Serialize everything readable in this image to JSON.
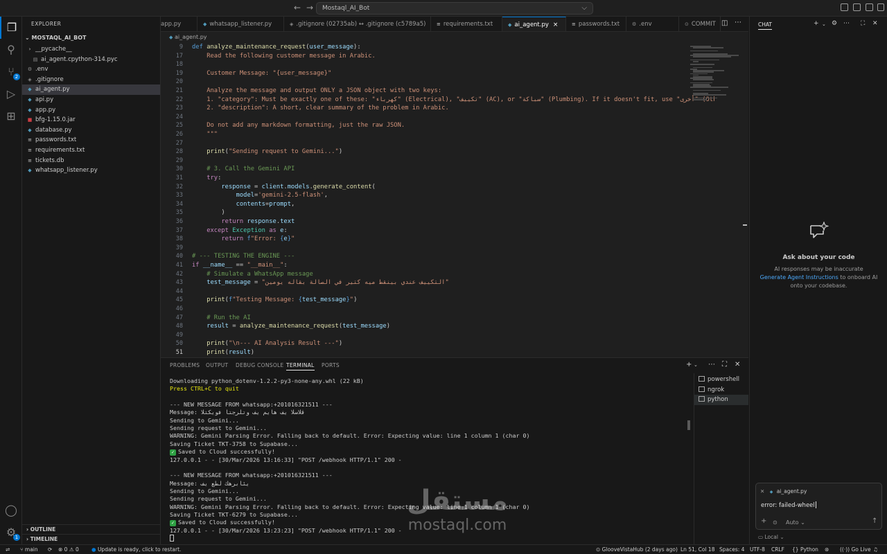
{
  "title": {
    "search": "Mostaql_AI_Bot"
  },
  "explorer": {
    "header": "EXPLORER",
    "project": "MOSTAQL_AI_BOT",
    "items": [
      {
        "label": "__pycache__",
        "icon": "folder-chevron-icon",
        "indent": 1
      },
      {
        "label": "ai_agent.cpython-314.pyc",
        "icon": "file-icon",
        "indent": 2
      },
      {
        "label": ".env",
        "icon": "gear-icon",
        "indent": 1
      },
      {
        "label": ".gitignore",
        "icon": "git-icon",
        "indent": 1
      },
      {
        "label": "ai_agent.py",
        "icon": "python-icon",
        "indent": 1,
        "selected": true
      },
      {
        "label": "api.py",
        "icon": "python-icon",
        "indent": 1
      },
      {
        "label": "app.py",
        "icon": "python-icon",
        "indent": 1
      },
      {
        "label": "bfg-1.15.0.jar",
        "icon": "jar-icon",
        "indent": 1
      },
      {
        "label": "database.py",
        "icon": "python-icon",
        "indent": 1
      },
      {
        "label": "passwords.txt",
        "icon": "text-file-icon",
        "indent": 1
      },
      {
        "label": "requirements.txt",
        "icon": "text-file-icon",
        "indent": 1
      },
      {
        "label": "tickets.db",
        "icon": "db-icon",
        "indent": 1
      },
      {
        "label": "whatsapp_listener.py",
        "icon": "python-icon",
        "indent": 1
      }
    ],
    "outline": "OUTLINE",
    "timeline": "TIMELINE"
  },
  "tabs": [
    {
      "label": "app.py",
      "icon": "python-icon"
    },
    {
      "label": "whatsapp_listener.py",
      "icon": "python-icon"
    },
    {
      "label": ".gitignore (02735ab) ↔ .gitignore (c5789a5)",
      "icon": "git-icon"
    },
    {
      "label": "requirements.txt",
      "icon": "text-file-icon"
    },
    {
      "label": "ai_agent.py",
      "icon": "python-icon",
      "active": true
    },
    {
      "label": "passwords.txt",
      "icon": "text-file-icon"
    },
    {
      "label": ".env",
      "icon": "gear-icon"
    },
    {
      "label": "COMMIT",
      "icon": "commit-icon"
    }
  ],
  "breadcrumb": "ai_agent.py",
  "code": {
    "lines": [
      {
        "n": "9",
        "html": "<span class=\"bl\">def</span> <span class=\"fn\">analyze_maintenance_request</span>(<span class=\"vr\">user_message</span>):"
      },
      {
        "n": "17",
        "html": "    <span class=\"st\">Read the following customer message in Arabic.</span>"
      },
      {
        "n": "18",
        "html": ""
      },
      {
        "n": "19",
        "html": "    <span class=\"st\">Customer Message: \"{user_message}\"</span>"
      },
      {
        "n": "20",
        "html": ""
      },
      {
        "n": "21",
        "html": "    <span class=\"st\">Analyze the message and output ONLY a JSON object with two keys:</span>"
      },
      {
        "n": "22",
        "html": "    <span class=\"st\">1. \"category\": Must be exactly one of these: \"كهرباء\" (Electrical), \"تكييف\" (AC), or \"سباكة\" (Plumbing). If it doesn't fit, use \"أخرى\" (Other).</span>"
      },
      {
        "n": "23",
        "html": "    <span class=\"st\">2. \"description\": A short, clear summary of the problem in Arabic.</span>"
      },
      {
        "n": "24",
        "html": ""
      },
      {
        "n": "25",
        "html": "    <span class=\"st\">Do not add any markdown formatting, just the raw JSON.</span>"
      },
      {
        "n": "26",
        "html": "    <span class=\"st\">\"\"\"</span>"
      },
      {
        "n": "27",
        "html": ""
      },
      {
        "n": "28",
        "html": "    <span class=\"fn\">print</span>(<span class=\"st\">\"Sending request to Gemini...\"</span>)"
      },
      {
        "n": "29",
        "html": ""
      },
      {
        "n": "30",
        "html": "    <span class=\"cm\"># 3. Call the Gemini API</span>"
      },
      {
        "n": "31",
        "html": "    <span class=\"kw\">try</span>:"
      },
      {
        "n": "32",
        "html": "        <span class=\"vr\">response</span> = <span class=\"vr\">client</span>.<span class=\"vr\">models</span>.<span class=\"fn\">generate_content</span>("
      },
      {
        "n": "33",
        "html": "            <span class=\"vr\">model</span>=<span class=\"st\">'gemini-2.5-flash'</span>,"
      },
      {
        "n": "34",
        "html": "            <span class=\"vr\">contents</span>=<span class=\"vr\">prompt</span>,"
      },
      {
        "n": "35",
        "html": "        )"
      },
      {
        "n": "36",
        "html": "        <span class=\"kw\">return</span> <span class=\"vr\">response</span>.<span class=\"vr\">text</span>"
      },
      {
        "n": "37",
        "html": "    <span class=\"kw\">except</span> <span class=\"cls\">Exception</span> <span class=\"kw\">as</span> <span class=\"vr\">e</span>:"
      },
      {
        "n": "38",
        "html": "        <span class=\"kw\">return</span> <span class=\"bl\">f</span><span class=\"st\">\"Error: </span><span class=\"bl\">{</span><span class=\"vr\">e</span><span class=\"bl\">}</span><span class=\"st\">\"</span>"
      },
      {
        "n": "39",
        "html": ""
      },
      {
        "n": "40",
        "html": "<span class=\"cm\"># --- TESTING THE ENGINE ---</span>"
      },
      {
        "n": "41",
        "html": "<span class=\"kw\">if</span> <span class=\"vr\">__name__</span> == <span class=\"st\">\"__main__\"</span>:"
      },
      {
        "n": "42",
        "html": "    <span class=\"cm\"># Simulate a WhatsApp message</span>"
      },
      {
        "n": "43",
        "html": "    <span class=\"vr\">test_message</span> = <span class=\"st\">\"التكييف عندي بينقط ميه كتير في الصالة بقاله يومين\"</span>"
      },
      {
        "n": "44",
        "html": ""
      },
      {
        "n": "45",
        "html": "    <span class=\"fn\">print</span>(<span class=\"bl\">f</span><span class=\"st\">\"Testing Message: </span><span class=\"bl\">{</span><span class=\"vr\">test_message</span><span class=\"bl\">}</span><span class=\"st\">\"</span>)"
      },
      {
        "n": "46",
        "html": ""
      },
      {
        "n": "47",
        "html": "    <span class=\"cm\"># Run the AI</span>"
      },
      {
        "n": "48",
        "html": "    <span class=\"vr\">result</span> = <span class=\"fn\">analyze_maintenance_request</span>(<span class=\"vr\">test_message</span>)"
      },
      {
        "n": "49",
        "html": ""
      },
      {
        "n": "50",
        "html": "    <span class=\"fn\">print</span>(<span class=\"st\">\"\\n--- AI Analysis Result ---\"</span>)"
      },
      {
        "n": "51",
        "html": "    <span class=\"fn\">print</span>(<span class=\"vr\">result</span>)",
        "current": true
      }
    ]
  },
  "panel": {
    "tabs": [
      "PROBLEMS",
      "OUTPUT",
      "DEBUG CONSOLE",
      "TERMINAL",
      "PORTS"
    ],
    "active_tab": "TERMINAL",
    "terminal_lines": [
      {
        "t": "Downloading python_dotenv-1.2.2-py3-none-any.whl (22 kB)",
        "c": ""
      },
      {
        "t": "Press CTRL+C to quit",
        "c": "y"
      },
      {
        "t": "",
        "c": ""
      },
      {
        "t": "--- NEW MESSAGE FROM whatsapp:+201016321511 ---",
        "c": ""
      },
      {
        "t": "Message: قلاسلا يف هايم يف وتلرجتا فويكتلا",
        "c": ""
      },
      {
        "t": "Sending to Gemini...",
        "c": ""
      },
      {
        "t": "Sending request to Gemini...",
        "c": ""
      },
      {
        "t": "WARNING: Gemini Parsing Error. Falling back to default. Error: Expecting value: line 1 column 1 (char 0)",
        "c": ""
      },
      {
        "t": "Saving Ticket TKT-3758 to Supabase...",
        "c": ""
      },
      {
        "t": "Saved to Cloud successfully!",
        "c": "",
        "check": true
      },
      {
        "t": "127.0.0.1 - - [30/Mar/2026 13:16:33] \"POST /webhook HTTP/1.1\" 200 -",
        "c": ""
      },
      {
        "t": "",
        "c": ""
      },
      {
        "t": "--- NEW MESSAGE FROM whatsapp:+201016321511 ---",
        "c": ""
      },
      {
        "t": "Message: يئابرهك لطع يف",
        "c": ""
      },
      {
        "t": "Sending to Gemini...",
        "c": ""
      },
      {
        "t": "Sending request to Gemini...",
        "c": ""
      },
      {
        "t": "WARNING: Gemini Parsing Error. Falling back to default. Error: Expecting value: line 1 column 1 (char 0)",
        "c": ""
      },
      {
        "t": "Saving Ticket TKT-6279 to Supabase...",
        "c": ""
      },
      {
        "t": "Saved to Cloud successfully!",
        "c": "",
        "check": true
      },
      {
        "t": "127.0.0.1 - - [30/Mar/2026 13:23:23] \"POST /webhook HTTP/1.1\" 200 -",
        "c": ""
      },
      {
        "t": "",
        "c": ""
      }
    ],
    "terminals": [
      {
        "label": "powershell"
      },
      {
        "label": "ngrok"
      },
      {
        "label": "python",
        "selected": true
      }
    ]
  },
  "chat": {
    "title": "CHAT",
    "empty_title": "Ask about your code",
    "note1": "AI responses may be inaccurate",
    "link": "Generate Agent Instructions",
    "note2_tail": "to onboard AI",
    "note3": "onto your codebase.",
    "context_chip": "ai_agent.py",
    "input_value": "error: failed-wheel",
    "mode": "Auto",
    "location": "Local"
  },
  "status": {
    "branch": "main",
    "problems": "0",
    "warnings": "0",
    "update": "Update is ready, click to restart.",
    "blame": "GlooveVistaHub (2 days ago)",
    "position": "Ln 51, Col 18",
    "spaces": "Spaces: 4",
    "encoding": "UTF-8",
    "eol": "CRLF",
    "language": "Python",
    "golive": "Go Live"
  },
  "watermark": {
    "arabic": "مستقل",
    "latin": "mostaql.com"
  },
  "colors": {
    "accent": "#0078d4",
    "editor_bg": "#1f1f1f",
    "sidebar_bg": "#181818"
  }
}
